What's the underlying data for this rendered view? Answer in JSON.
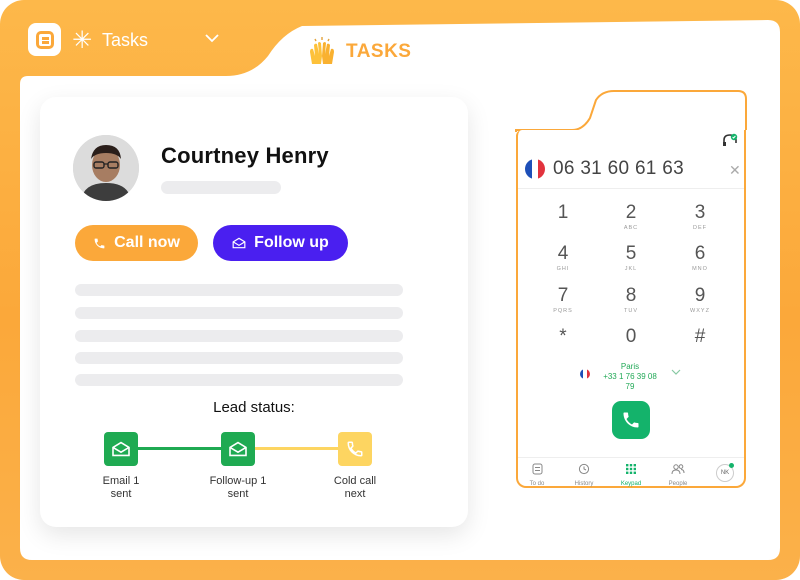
{
  "header": {
    "app_title": "Tasks",
    "section_title": "TASKS"
  },
  "contact": {
    "name": "Courtney Henry",
    "call_button": "Call now",
    "follow_button": "Follow up",
    "lead_status_label": "Lead status:",
    "steps": [
      {
        "caption_line1": "Email 1",
        "caption_line2": "sent",
        "state": "done"
      },
      {
        "caption_line1": "Follow-up 1",
        "caption_line2": "sent",
        "state": "done"
      },
      {
        "caption_line1": "Cold call",
        "caption_line2": "next",
        "state": "next"
      }
    ]
  },
  "dialer": {
    "number": "06 31 60 61 63",
    "keys": [
      {
        "digit": "1",
        "letters": ""
      },
      {
        "digit": "2",
        "letters": "ABC"
      },
      {
        "digit": "3",
        "letters": "DEF"
      },
      {
        "digit": "4",
        "letters": "GHI"
      },
      {
        "digit": "5",
        "letters": "JKL"
      },
      {
        "digit": "6",
        "letters": "MNO"
      },
      {
        "digit": "7",
        "letters": "PQRS"
      },
      {
        "digit": "8",
        "letters": "TUV"
      },
      {
        "digit": "9",
        "letters": "WXYZ"
      },
      {
        "digit": "*",
        "letters": ""
      },
      {
        "digit": "0",
        "letters": ""
      },
      {
        "digit": "#",
        "letters": ""
      }
    ],
    "caller_city": "Paris",
    "caller_number": "+33 1 76 39 08 79",
    "nav": [
      {
        "label": "To do",
        "icon": "todo-icon"
      },
      {
        "label": "History",
        "icon": "history-icon"
      },
      {
        "label": "Keypad",
        "icon": "keypad-icon",
        "active": true
      },
      {
        "label": "People",
        "icon": "people-icon"
      }
    ],
    "user_initials": "NK"
  },
  "colors": {
    "brand_orange": "#fba83a",
    "follow_purple": "#4a1ff0",
    "success_green": "#14b36b",
    "pending_yellow": "#fdd561"
  }
}
